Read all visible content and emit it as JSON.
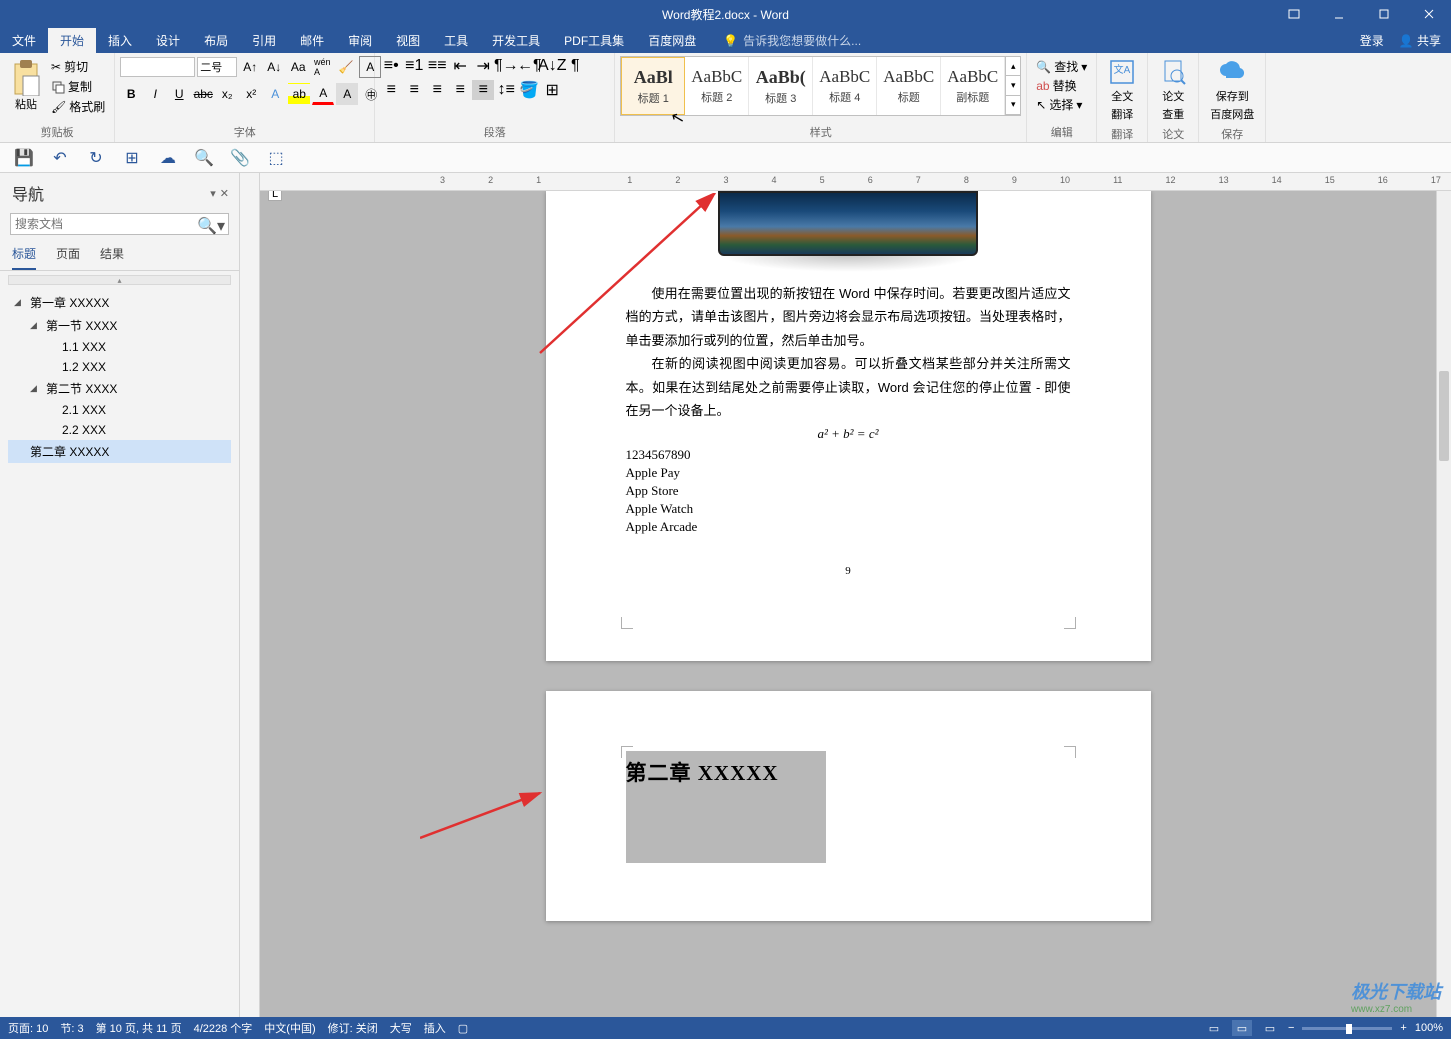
{
  "title": "Word教程2.docx - Word",
  "menu": {
    "file": "文件",
    "tabs": [
      "开始",
      "插入",
      "设计",
      "布局",
      "引用",
      "邮件",
      "审阅",
      "视图",
      "工具",
      "开发工具",
      "PDF工具集",
      "百度网盘"
    ],
    "active_index": 0,
    "tell_me": "告诉我您想要做什么...",
    "login": "登录",
    "share": "共享"
  },
  "ribbon": {
    "clipboard": {
      "label": "剪贴板",
      "paste": "粘贴",
      "cut": "剪切",
      "copy": "复制",
      "painter": "格式刷"
    },
    "font": {
      "label": "字体",
      "name": "",
      "size": "二号"
    },
    "paragraph": {
      "label": "段落"
    },
    "styles": {
      "label": "样式",
      "items": [
        {
          "preview": "AaBl",
          "name": "标题 1",
          "hover": true,
          "strong": true
        },
        {
          "preview": "AaBbC",
          "name": "标题 2"
        },
        {
          "preview": "AaBb(",
          "name": "标题 3",
          "strong": true
        },
        {
          "preview": "AaBbC",
          "name": "标题 4"
        },
        {
          "preview": "AaBbC",
          "name": "标题"
        },
        {
          "preview": "AaBbC",
          "name": "副标题"
        }
      ]
    },
    "editing": {
      "label": "编辑",
      "find": "查找",
      "replace": "替换",
      "select": "选择"
    },
    "fulltrans": {
      "label": "翻译",
      "line1": "全文",
      "line2": "翻译"
    },
    "thesis": {
      "label": "论文",
      "line1": "论文",
      "line2": "查重"
    },
    "savecloud": {
      "label": "保存",
      "line1": "保存到",
      "line2": "百度网盘"
    }
  },
  "nav": {
    "title": "导航",
    "placeholder": "搜索文档",
    "tabs": [
      "标题",
      "页面",
      "结果"
    ],
    "tree": [
      {
        "level": 1,
        "text": "第一章 XXXXX",
        "expand": true
      },
      {
        "level": 2,
        "text": "第一节 XXXX",
        "expand": true
      },
      {
        "level": 3,
        "text": "1.1 XXX"
      },
      {
        "level": 3,
        "text": "1.2 XXX"
      },
      {
        "level": 2,
        "text": "第二节 XXXX",
        "expand": true
      },
      {
        "level": 3,
        "text": "2.1 XXX"
      },
      {
        "level": 3,
        "text": "2.2 XXX"
      },
      {
        "level": 1,
        "text": "第二章 XXXXX",
        "selected": true
      }
    ]
  },
  "doc": {
    "para1": "使用在需要位置出现的新按钮在 Word 中保存时间。若要更改图片适应文档的方式，请单击该图片，图片旁边将会显示布局选项按钮。当处理表格时，单击要添加行或列的位置，然后单击加号。",
    "para2": "在新的阅读视图中阅读更加容易。可以折叠文档某些部分并关注所需文本。如果在达到结尾处之前需要停止读取，Word 会记住您的停止位置 - 即使在另一个设备上。",
    "equation": "a² + b² = c²",
    "lines": [
      "1234567890",
      "Apple Pay",
      "App Store",
      "Apple Watch",
      "Apple Arcade"
    ],
    "pagenum": "9",
    "heading2": "第二章 XXXXX"
  },
  "ruler": [
    "3",
    "2",
    "1",
    "",
    "1",
    "2",
    "3",
    "4",
    "5",
    "6",
    "7",
    "8",
    "9",
    "10",
    "11",
    "12",
    "13",
    "14",
    "15",
    "16",
    "17"
  ],
  "status": {
    "page": "页面: 10",
    "section": "节: 3",
    "pagecount": "第 10 页, 共 11 页",
    "words": "4/2228 个字",
    "lang": "中文(中国)",
    "track": "修订: 关闭",
    "caps": "大写",
    "insert": "插入",
    "zoom": "100%"
  },
  "watermark": {
    "brand": "极光下载站",
    "url": "www.xz7.com"
  }
}
